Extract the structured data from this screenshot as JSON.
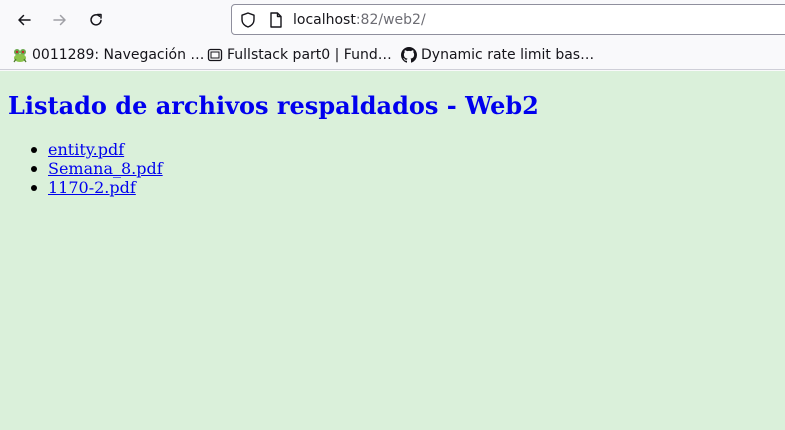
{
  "toolbar": {
    "url_host": "localhost",
    "url_rest": ":82/web2/"
  },
  "bookmarks": [
    {
      "label": "0011289: Navegación …",
      "icon": "frog-favicon-icon"
    },
    {
      "label": "Fullstack part0 | Fund…",
      "icon": "page-favicon-icon"
    },
    {
      "label": "Dynamic rate limit bas…",
      "icon": "github-icon"
    }
  ],
  "page": {
    "title": "Listado de archivos respaldados - Web2",
    "files": [
      "entity.pdf",
      "Semana_8.pdf",
      "1170-2.pdf"
    ]
  },
  "colors": {
    "page_background": "#daf0da",
    "link": "#0000ee"
  }
}
